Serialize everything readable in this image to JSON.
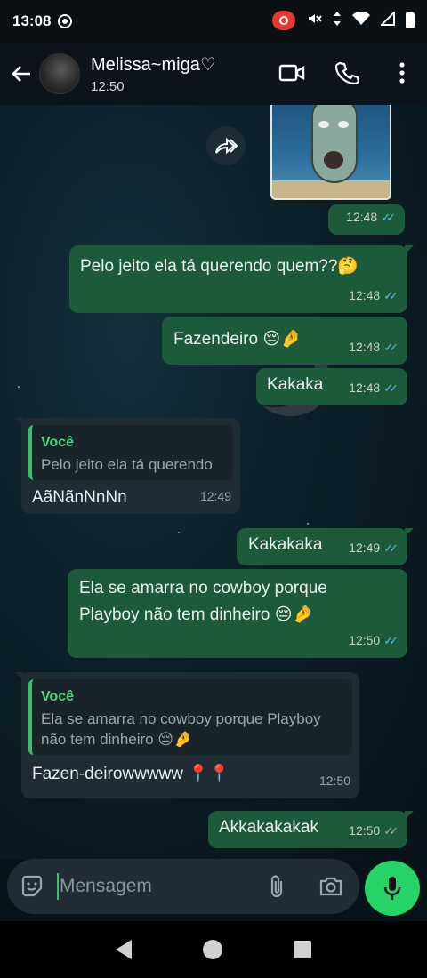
{
  "status_bar": {
    "time": "13:08"
  },
  "header": {
    "contact_name": "Melissa~miga♡",
    "contact_status": "12:50"
  },
  "messages": [
    {
      "type": "image",
      "direction": "out",
      "time": "12:48"
    },
    {
      "direction": "out",
      "text": "Pelo jeito ela tá querendo quem??🤔",
      "time": "12:48"
    },
    {
      "direction": "out",
      "text": "Fazendeiro 😔🤌",
      "time": "12:48"
    },
    {
      "direction": "out",
      "text": "Kakaka",
      "time": "12:48"
    },
    {
      "direction": "in",
      "quote_author": "Você",
      "quote_text": "Pelo jeito ela tá querendo",
      "text": "AãNãnNnNn",
      "time": "12:49"
    },
    {
      "direction": "out",
      "text": "Kakakaka",
      "time": "12:49"
    },
    {
      "direction": "out",
      "text_line1": "Ela se amarra no cowboy porque",
      "text_line2": "Playboy não tem dinheiro 😔🤌",
      "time": "12:50"
    },
    {
      "direction": "in",
      "quote_author": "Você",
      "quote_line1": "Ela se amarra no cowboy porque Playboy",
      "quote_line2": "não tem dinheiro 😔🤌",
      "text": "Fazen-deirowwwww 📍📍",
      "time": "12:50"
    },
    {
      "direction": "out",
      "text": "Akkakakakak",
      "time": "12:50"
    }
  ],
  "composer": {
    "placeholder": "Mensagem"
  },
  "colors": {
    "outgoing_bubble": "#1d5a3a",
    "incoming_bubble": "#1f2c33",
    "accent": "#25d366",
    "read_ticks": "#53bdeb"
  }
}
